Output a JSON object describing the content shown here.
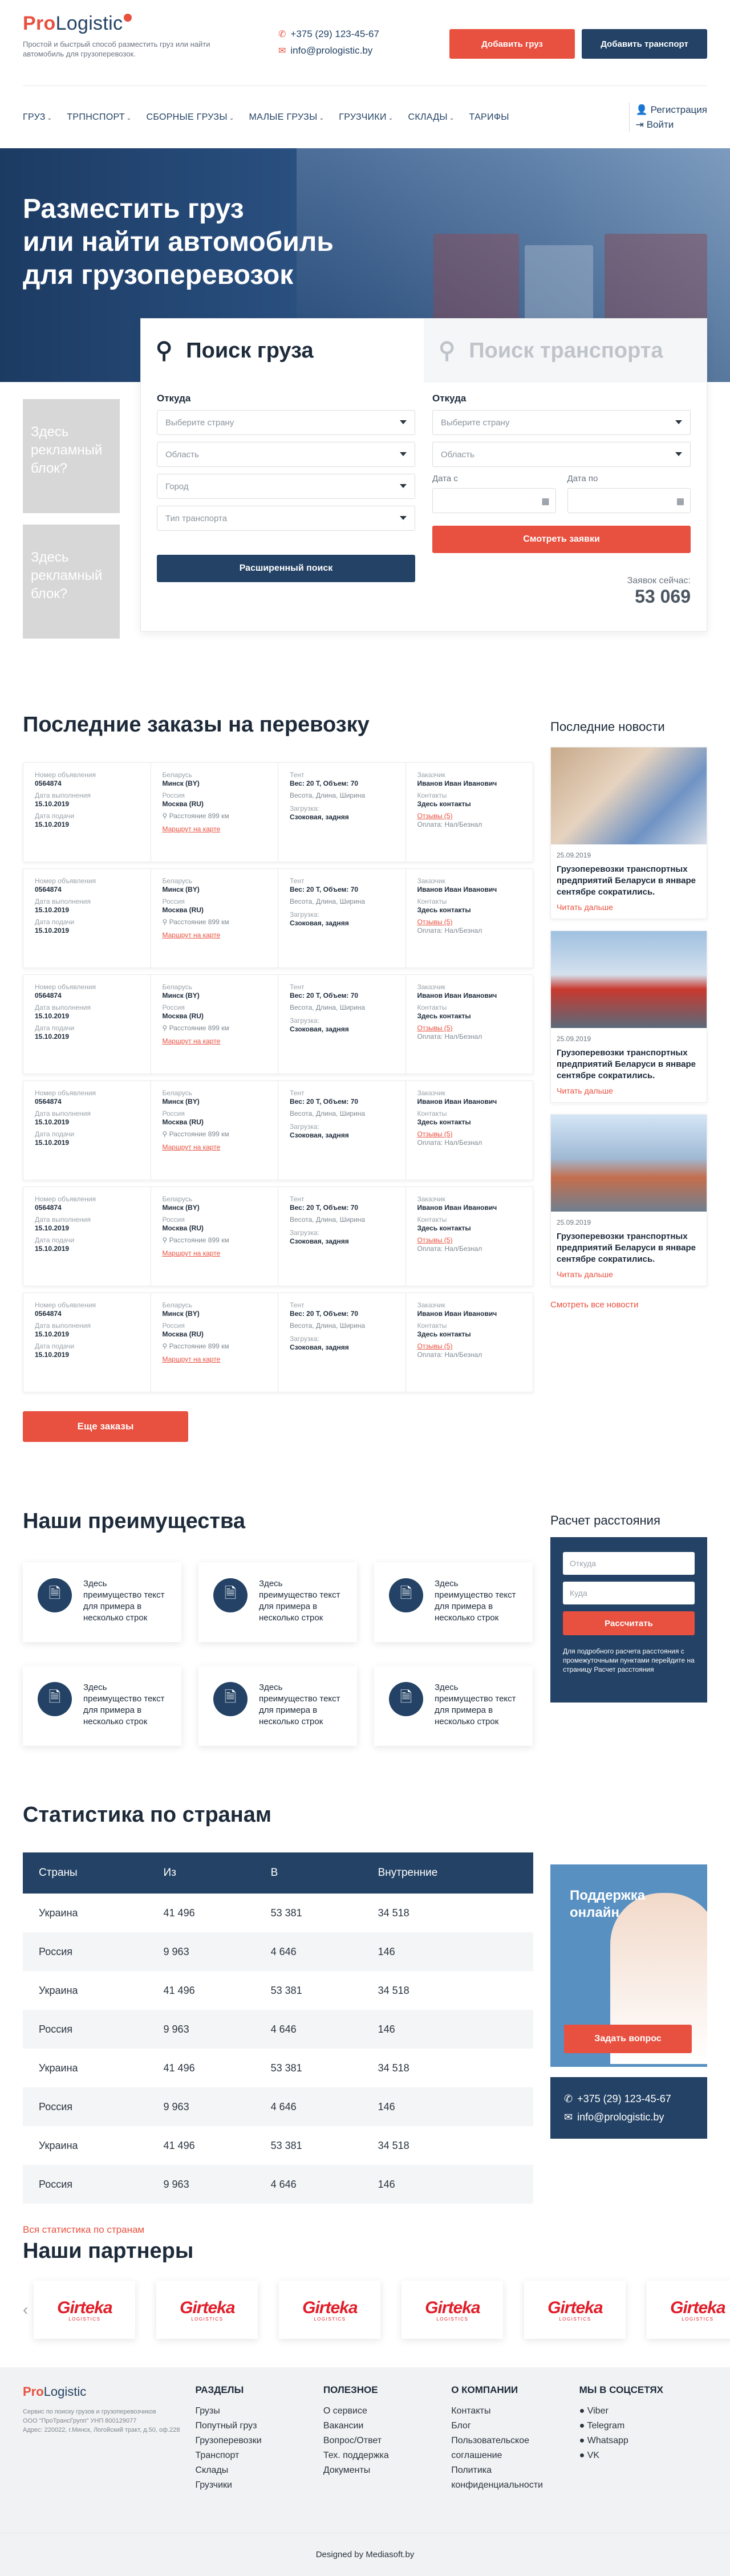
{
  "header": {
    "logo_pro": "Pro",
    "logo_rest": "Logistic",
    "tagline": "Простой и быстрый способ разместить груз или найти автомобиль для грузоперевозок.",
    "phone": "+375 (29) 123-45-67",
    "email": "info@prologistic.by",
    "btn_add_cargo": "Добавить груз",
    "btn_add_transport": "Добавить транспорт"
  },
  "nav": {
    "items": [
      "ГРУЗ",
      "ТРПНСПОРТ",
      "СБОРНЫЕ ГРУЗЫ",
      "МАЛЫЕ ГРУЗЫ",
      "ГРУЗЧИКИ",
      "СКЛАДЫ",
      "ТАРИФЫ"
    ],
    "register": "Регистрация",
    "login": "Войти"
  },
  "hero": {
    "line1": "Разместить груз",
    "line2": "или найти автомобиль",
    "line3": "для грузоперевозок"
  },
  "ads": [
    "Здесь рекламный блок?",
    "Здесь рекламный блок?"
  ],
  "search": {
    "tab_cargo": "Поиск груза",
    "tab_transport": "Поиск транспорта",
    "left_label": "Откуда",
    "right_label": "Откуда",
    "left_fields": [
      "Выберите страну",
      "Область",
      "Город",
      "Тип транспорта"
    ],
    "right_fields": [
      "Выберите страну",
      "Область"
    ],
    "date_from": "Дата с",
    "date_to": "Дата по",
    "btn_advanced": "Расширенный поиск",
    "btn_view": "Смотреть заявки",
    "now_label": "Заявок сейчас:",
    "now_value": "53 069"
  },
  "orders": {
    "title": "Последние заказы на перевозку",
    "labels": {
      "num": "Номер объявления",
      "done": "Дата выполнения",
      "sent": "Дата подачи",
      "tent": "Тент",
      "load": "Загрузка:",
      "customer": "Заказчик",
      "contacts": "Контакты"
    },
    "rows": [
      {
        "num": "0564874",
        "done": "15.10.2019",
        "sent": "15.10.2019",
        "from_country": "Беларусь",
        "from_city": "Минск (BY)",
        "to_country": "Россия",
        "to_city": "Москва (RU)",
        "dist": "Расстояние 899 км",
        "map": "Маршрут на карте",
        "cargo": "Вес: 20 Т, Объем: 70",
        "dims": "Весота, Длина, Ширина",
        "load": "Сзоковая, задняя",
        "cust": "Иванов Иван Иванович",
        "cont": "Здесь контакты",
        "reviews": "Отзывы (5)",
        "pay": "Оплата: Нал/Безнал"
      },
      {
        "num": "0564874",
        "done": "15.10.2019",
        "sent": "15.10.2019",
        "from_country": "Беларусь",
        "from_city": "Минск (BY)",
        "to_country": "Россия",
        "to_city": "Москва (RU)",
        "dist": "Расстояние 899 км",
        "map": "Маршрут на карте",
        "cargo": "Вес: 20 Т, Объем: 70",
        "dims": "Весота, Длина, Ширина",
        "load": "Сзоковая, задняя",
        "cust": "Иванов Иван Иванович",
        "cont": "Здесь контакты",
        "reviews": "Отзывы (5)",
        "pay": "Оплата: Нал/Безнал"
      },
      {
        "num": "0564874",
        "done": "15.10.2019",
        "sent": "15.10.2019",
        "from_country": "Беларусь",
        "from_city": "Минск (BY)",
        "to_country": "Россия",
        "to_city": "Москва (RU)",
        "dist": "Расстояние 899 км",
        "map": "Маршрут на карте",
        "cargo": "Вес: 20 Т, Объем: 70",
        "dims": "Весота, Длина, Ширина",
        "load": "Сзоковая, задняя",
        "cust": "Иванов Иван Иванович",
        "cont": "Здесь контакты",
        "reviews": "Отзывы (5)",
        "pay": "Оплата: Нал/Безнал"
      },
      {
        "num": "0564874",
        "done": "15.10.2019",
        "sent": "15.10.2019",
        "from_country": "Беларусь",
        "from_city": "Минск (BY)",
        "to_country": "Россия",
        "to_city": "Москва (RU)",
        "dist": "Расстояние 899 км",
        "map": "Маршрут на карте",
        "cargo": "Вес: 20 Т, Объем: 70",
        "dims": "Весота, Длина, Ширина",
        "load": "Сзоковая, задняя",
        "cust": "Иванов Иван Иванович",
        "cont": "Здесь контакты",
        "reviews": "Отзывы (5)",
        "pay": "Оплата: Нал/Безнал"
      },
      {
        "num": "0564874",
        "done": "15.10.2019",
        "sent": "15.10.2019",
        "from_country": "Беларусь",
        "from_city": "Минск (BY)",
        "to_country": "Россия",
        "to_city": "Москва (RU)",
        "dist": "Расстояние 899 км",
        "map": "Маршрут на карте",
        "cargo": "Вес: 20 Т, Объем: 70",
        "dims": "Весота, Длина, Ширина",
        "load": "Сзоковая, задняя",
        "cust": "Иванов Иван Иванович",
        "cont": "Здесь контакты",
        "reviews": "Отзывы (5)",
        "pay": "Оплата: Нал/Безнал"
      },
      {
        "num": "0564874",
        "done": "15.10.2019",
        "sent": "15.10.2019",
        "from_country": "Беларусь",
        "from_city": "Минск (BY)",
        "to_country": "Россия",
        "to_city": "Москва (RU)",
        "dist": "Расстояние 899 км",
        "map": "Маршрут на карте",
        "cargo": "Вес: 20 Т, Объем: 70",
        "dims": "Весота, Длина, Ширина",
        "load": "Сзоковая, задняя",
        "cust": "Иванов Иван Иванович",
        "cont": "Здесь контакты",
        "reviews": "Отзывы (5)",
        "pay": "Оплата: Нал/Безнал"
      }
    ],
    "more": "Еще заказы"
  },
  "news": {
    "title": "Последние новости",
    "items": [
      {
        "date": "25.09.2019",
        "title": "Грузоперевозки транспортных предприятий Беларуси в январе сентябре сократились.",
        "link": "Читать дальше"
      },
      {
        "date": "25.09.2019",
        "title": "Грузоперевозки транспортных предприятий Беларуси в январе сентябре сократились.",
        "link": "Читать дальше"
      },
      {
        "date": "25.09.2019",
        "title": "Грузоперевозки транспортных предприятий Беларуси в январе сентябре сократились.",
        "link": "Читать дальше"
      }
    ],
    "all": "Смотреть все новости"
  },
  "advantages": {
    "title": "Наши преимущества",
    "items": [
      "Здесь преимущество текст для примера в несколько строк",
      "Здесь преимущество текст для примера в несколько строк",
      "Здесь преимущество текст для примера в несколько строк",
      "Здесь преимущество текст для примера в несколько строк",
      "Здесь преимущество текст для примера в несколько строк",
      "Здесь преимущество текст для примера в несколько строк"
    ]
  },
  "calc": {
    "title": "Расчет расстояния",
    "from": "Откуда",
    "to": "Куда",
    "btn": "Рассчитать",
    "note": "Для подробного расчета расстояния с промежуточными пунктами перейдите на страницу Расчет расстояния"
  },
  "stats": {
    "title": "Статистика по странам",
    "headers": [
      "Страны",
      "Из",
      "В",
      "Внутренние"
    ],
    "rows": [
      [
        "Украина",
        "41 496",
        "53 381",
        "34 518"
      ],
      [
        "Россия",
        "9 963",
        "4 646",
        "146"
      ],
      [
        "Украина",
        "41 496",
        "53 381",
        "34 518"
      ],
      [
        "Россия",
        "9 963",
        "4 646",
        "146"
      ],
      [
        "Украина",
        "41 496",
        "53 381",
        "34 518"
      ],
      [
        "Россия",
        "9 963",
        "4 646",
        "146"
      ],
      [
        "Украина",
        "41 496",
        "53 381",
        "34 518"
      ],
      [
        "Россия",
        "9 963",
        "4 646",
        "146"
      ]
    ],
    "all": "Вся статистика по странам"
  },
  "support": {
    "title_line1": "Поддержка",
    "title_line2": "онлайн",
    "btn": "Задать вопрос",
    "phone": "+375 (29) 123-45-67",
    "email": "info@prologistic.by"
  },
  "partners": {
    "title": "Наши партнеры",
    "logo_name": "Girteka",
    "logo_sub": "LOGISTICS",
    "count": 6
  },
  "footer": {
    "logo_pro": "Pro",
    "logo_rest": "Logistic",
    "desc": "Сервис по поиску грузов и грузоперевозчиков",
    "company": "ООО \"ПроТрансГрупп\" УНП 800129077",
    "address": "Адрес: 220022, г.Минск, Логойский тракт, д.50, оф.228",
    "cols": [
      {
        "h": "РАЗДЕЛЫ",
        "items": [
          "Грузы",
          "Попутный груз",
          "Грузоперевозки",
          "Транспорт",
          "Склады",
          "Грузчики"
        ]
      },
      {
        "h": "ПОЛЕЗНОЕ",
        "items": [
          "О сервисе",
          "Вакансии",
          "Вопрос/Ответ",
          "Тех. поддержка",
          "Документы"
        ]
      },
      {
        "h": "О КОМПАНИИ",
        "items": [
          "Контакты",
          "Блог",
          "Пользовательское соглашение",
          "Политика конфиденциальности"
        ]
      },
      {
        "h": "МЫ В СОЦСЕТЯХ",
        "items": [
          "Viber",
          "Telegram",
          "Whatsapp",
          "VK"
        ]
      }
    ],
    "designed": "Designed by Mediasoft.by"
  },
  "colors": {
    "accent": "#e8503f",
    "navy": "#234265"
  }
}
